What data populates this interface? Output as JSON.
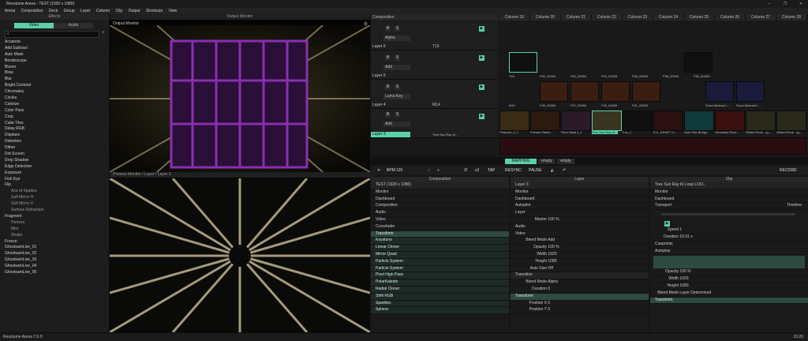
{
  "window": {
    "title": "Resolume Arena - TEST (1920 x 1080)"
  },
  "menu": [
    "Arena",
    "Composition",
    "Deck",
    "Group",
    "Layer",
    "Column",
    "Clip",
    "Output",
    "Shortcuts",
    "View"
  ],
  "effects": {
    "header": "Effects",
    "tab_video": "Video",
    "tab_audio": "Audio",
    "items": [
      "Acuarela",
      "Add Subtract",
      "Auto Mask",
      "Bendoscope",
      "Bloom",
      "Blow",
      "Blur",
      "Bright.Contrast",
      "Chromatey",
      "Circles",
      "Colorize",
      "Color Pass",
      "Crop",
      "Cube Tiles",
      "Delay RGB",
      "Displace",
      "Distortion",
      "Dither",
      "Dot Screen",
      "Drop Shadow",
      "Edge Detection",
      "Exposure",
      "Fish Eye",
      "Flip",
      "Ace of Spades",
      "Soft Mirror H",
      "Soft Mirror V",
      "Surface Refraction",
      "Fragment",
      "Horizon",
      "Mist",
      "Shake",
      "Freeze",
      "GhostsamLive_01",
      "GhostsamLive_02",
      "GhostsamLive_03",
      "GhostsamLive_04",
      "GhostsamLive_05"
    ]
  },
  "output_monitor": {
    "header": "Output Monitor",
    "label": "Output Monitor"
  },
  "preview_monitor": {
    "label": "Preview Monitor / Layer / Layer 3"
  },
  "deck": {
    "composition_label": "Composition",
    "columns": [
      "Column 19",
      "Column 20",
      "Column 21",
      "Column 22",
      "Column 23",
      "Column 24",
      "Column 25",
      "Column 26",
      "Column 27",
      "Column 28"
    ],
    "layers": [
      {
        "name": "Layer 6",
        "blend": "Alpha",
        "clip": "T16"
      },
      {
        "name": "Layer 5",
        "blend": "Add",
        "clip": "T16"
      },
      {
        "name": "Layer 4",
        "blend": "Luma Key",
        "clip": "M14"
      },
      {
        "name": "Layer 3",
        "blend": "Add",
        "clip": "Tree Sun Ray Ki..."
      }
    ],
    "row_labels_layer5": [
      "T16",
      "F50_00000",
      "F52_00000",
      "F54_00026",
      "F56_00000",
      "F58_00000",
      "F60_00000"
    ],
    "row_labels_layer4": [
      "M19",
      "F45_00000",
      "F47_00000",
      "F49_00000",
      "F51_00000",
      "Dooa Abstract L...",
      "Dooa Abstract L..."
    ],
    "row_labels_layer3": [
      "Pharaoh_2_1",
      "Friends Patter...",
      "Pixel Salat 4_1",
      "Tree Sun Ray Ki...",
      "Fox_1",
      "Fx1_04KMT H...",
      "Sale Ellis Bridge...",
      "Geometry Pixel...",
      "Gilded Rock - Ig...",
      "Gilded Rock - Ig..."
    ]
  },
  "deck_tabs": [
    "MAPPING",
    "empty",
    "empty"
  ],
  "transport": {
    "bpm_label": "BPM",
    "bpm": "120",
    "div2": "/2",
    "mul2": "x2",
    "tap": "TAP",
    "resync": "RESYNC",
    "pause": "PAUSE",
    "record": "RECORD"
  },
  "composition_panel": {
    "header": "Composition",
    "name": "TEST (1920 x 1080)",
    "sections": [
      "Monitor",
      "Dashboard",
      "Composition",
      "Audio",
      "Video",
      "Crossfader"
    ],
    "transform": "Transform",
    "effects": [
      "Keystone",
      "Linear Cloner",
      "Mirror Quad",
      "Particle System",
      "Particle System",
      "Pixel High Pass",
      "PolarKaleido",
      "Radial Cloner",
      "Shift RGB",
      "Sparkles",
      "Sphere"
    ]
  },
  "layer_panel": {
    "header": "Layer",
    "name": "Layer 3",
    "sections": [
      "Monitor",
      "Dashboard",
      "Autopilot",
      "Layer"
    ],
    "master_label": "Master",
    "master_value": "100 %",
    "audio": "Audio",
    "video": "Video",
    "blend_mode_label": "Blend Mode",
    "blend_mode_value": "Add",
    "opacity_label": "Opacity",
    "opacity_value": "100 %",
    "width_label": "Width",
    "width_value": "1920",
    "height_label": "Height",
    "height_value": "1080",
    "autosize_label": "Auto Size",
    "autosize_value": "Off",
    "transition": "Transition",
    "t_blend_label": "Blend Mode",
    "t_blend_value": "Alpha",
    "duration_label": "Duration",
    "duration_value": "0",
    "transform": "Transform",
    "posx_label": "Position X",
    "posx_value": "0",
    "posy_label": "Position Y",
    "posy_value": "0"
  },
  "clip_panel": {
    "header": "Clip",
    "name": "Tree Sun Ray Ki Loop LOO...",
    "sections": [
      "Monitor",
      "Dashboard",
      "Transport"
    ],
    "timeline": "Timeline",
    "speed_label": "Speed",
    "speed_value": "1",
    "duration_label": "Duration",
    "duration_value": "10.01 s",
    "cuepoints": "Cuepoints",
    "autoplay": "Autoplay",
    "opacity_label": "Opacity",
    "opacity_value": "100 %",
    "width_label": "Width",
    "width_value": "1920",
    "height_label": "Height",
    "height_value": "1080",
    "blend_label": "Blend Mode",
    "blend_value": "Layer Determined",
    "transform": "Transform"
  },
  "status": {
    "version": "Resolume Arena 7.6.0",
    "time": "15:20"
  },
  "colors": {
    "accent": "#5bd1a8",
    "purple": "#7a2a9a"
  }
}
